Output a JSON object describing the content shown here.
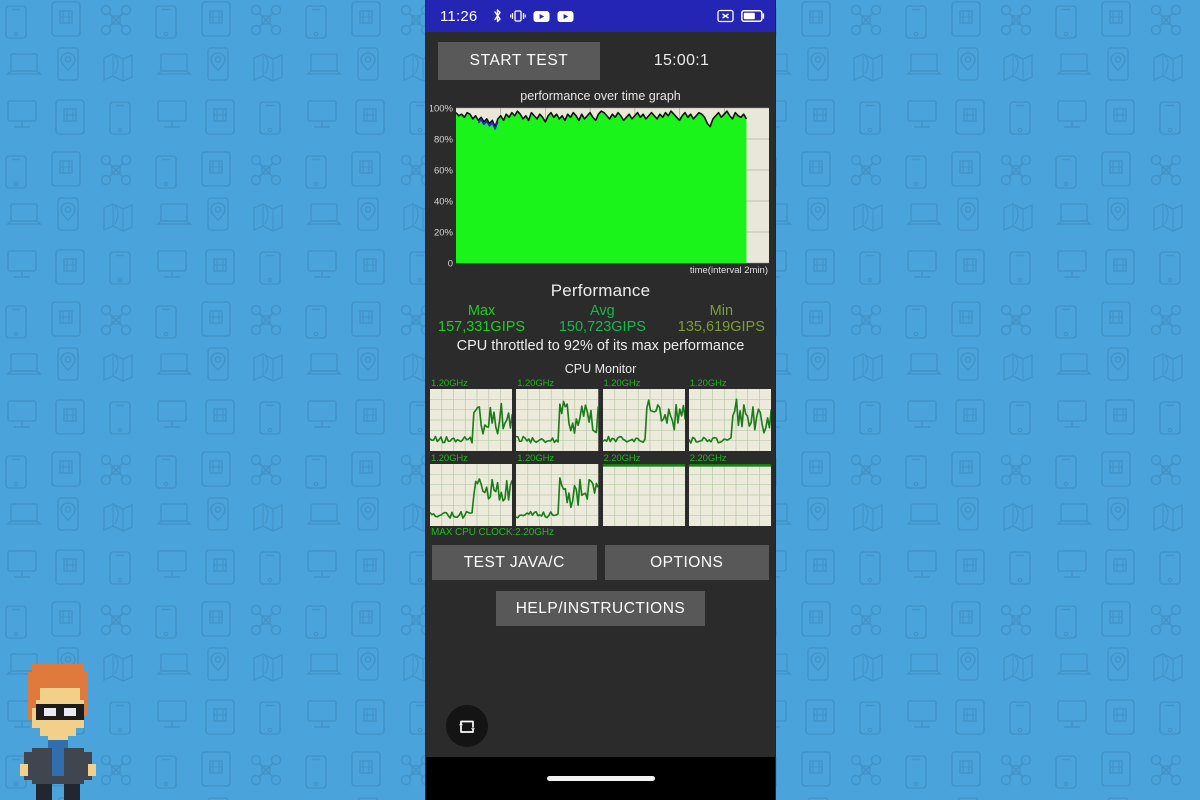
{
  "desktop": {
    "wallpaper": {
      "name": "tech-devices-pattern-wallpaper",
      "background_color": "#4aa3db",
      "line_color": "#3a86b8"
    },
    "avatar": {
      "name": "pixel-art-character",
      "hair_color": "#e0793c",
      "skin_color": "#f2d08a",
      "glasses_color": "#1c1c1c",
      "suit_color": "#3f4650",
      "shirt_color": "#2f6fb0"
    }
  },
  "statusbar": {
    "clock": "11:26",
    "left_icons": [
      "bluetooth-icon",
      "vibrate-icon",
      "youtube-icon",
      "youtube-icon"
    ],
    "right_icons": [
      "no-sim-icon",
      "battery-icon"
    ],
    "background_color": "#2525b5",
    "battery_level_percent": 60
  },
  "app": {
    "toolbar": {
      "start_test_label": "START TEST",
      "timer": "15:00:1"
    },
    "graph": {
      "title": "performance over time graph",
      "xlabel": "time(interval 2min)",
      "y_ticks": [
        "100%",
        "80%",
        "60%",
        "40%",
        "20%",
        "0"
      ],
      "fill_color": "#1bf41b",
      "line_color": "#111111",
      "accent_line_color": "#2222dd",
      "plot_background": "#e9e6da"
    },
    "performance": {
      "heading": "Performance",
      "max_label": "Max 157,331GIPS",
      "avg_label": "Avg 150,723GIPS",
      "min_label": "Min 135,619GIPS",
      "max_value": 157331,
      "avg_value": 150723,
      "min_value": 135619,
      "unit": "GIPS",
      "throttle_text": "CPU throttled to 92% of its max performance",
      "throttle_percent": 92
    },
    "cpu_monitor": {
      "heading": "CPU Monitor",
      "max_clock_label": "MAX CPU CLOCK:2.20GHz",
      "max_clock": "2.20GHz",
      "cores": [
        {
          "freq": "1.20GHz",
          "active": true
        },
        {
          "freq": "1.20GHz",
          "active": true
        },
        {
          "freq": "1.20GHz",
          "active": true
        },
        {
          "freq": "1.20GHz",
          "active": true
        },
        {
          "freq": "1.20GHz",
          "active": true
        },
        {
          "freq": "1.20GHz",
          "active": true
        },
        {
          "freq": "2.20GHz",
          "active": false
        },
        {
          "freq": "2.20GHz",
          "active": false
        }
      ],
      "panel_background": "#eceadb",
      "grid_color": "#b9c9a8",
      "trace_color": "#1a7d1a"
    },
    "buttons": {
      "test_java_c": "TEST JAVA/C",
      "options": "OPTIONS",
      "help_instructions": "HELP/INSTRUCTIONS"
    },
    "fab": {
      "icon": "repeat-icon"
    },
    "navbar": {
      "indicator": "home-indicator"
    }
  },
  "chart_data": {
    "type": "area",
    "title": "performance over time graph",
    "xlabel": "time(interval 2min)",
    "ylabel": "",
    "ylim": [
      0,
      100
    ],
    "ytick_values": [
      0,
      20,
      40,
      60,
      80,
      100
    ],
    "ytick_labels": [
      "0",
      "20%",
      "40%",
      "60%",
      "80%",
      "100%"
    ],
    "grid": true,
    "series": [
      {
        "name": "performance",
        "unit": "%",
        "values": [
          97,
          95,
          96,
          94,
          97,
          96,
          93,
          95,
          92,
          94,
          91,
          93,
          90,
          92,
          88,
          93,
          95,
          92,
          96,
          94,
          97,
          95,
          98,
          96,
          93,
          95,
          92,
          97,
          95,
          93,
          96,
          94,
          91,
          95,
          97,
          94,
          96,
          93,
          95,
          92,
          96,
          94,
          97,
          95,
          92,
          96,
          93,
          95,
          97,
          94,
          92,
          96,
          98,
          97,
          95,
          93,
          96,
          94,
          97,
          95,
          92,
          94,
          96,
          93,
          95,
          97,
          94,
          96,
          93,
          95,
          97,
          95,
          93,
          96,
          94,
          97,
          95,
          98,
          96,
          94,
          92,
          95,
          97,
          94,
          96,
          93,
          95,
          97,
          96,
          94,
          90,
          88,
          93,
          95,
          97,
          94,
          96,
          98,
          95,
          93,
          97,
          95,
          94,
          96,
          93
        ]
      }
    ],
    "annotations": [
      "Max 157,331GIPS",
      "Avg 150,723GIPS",
      "Min 135,619GIPS",
      "CPU throttled to 92% of its max performance"
    ]
  }
}
